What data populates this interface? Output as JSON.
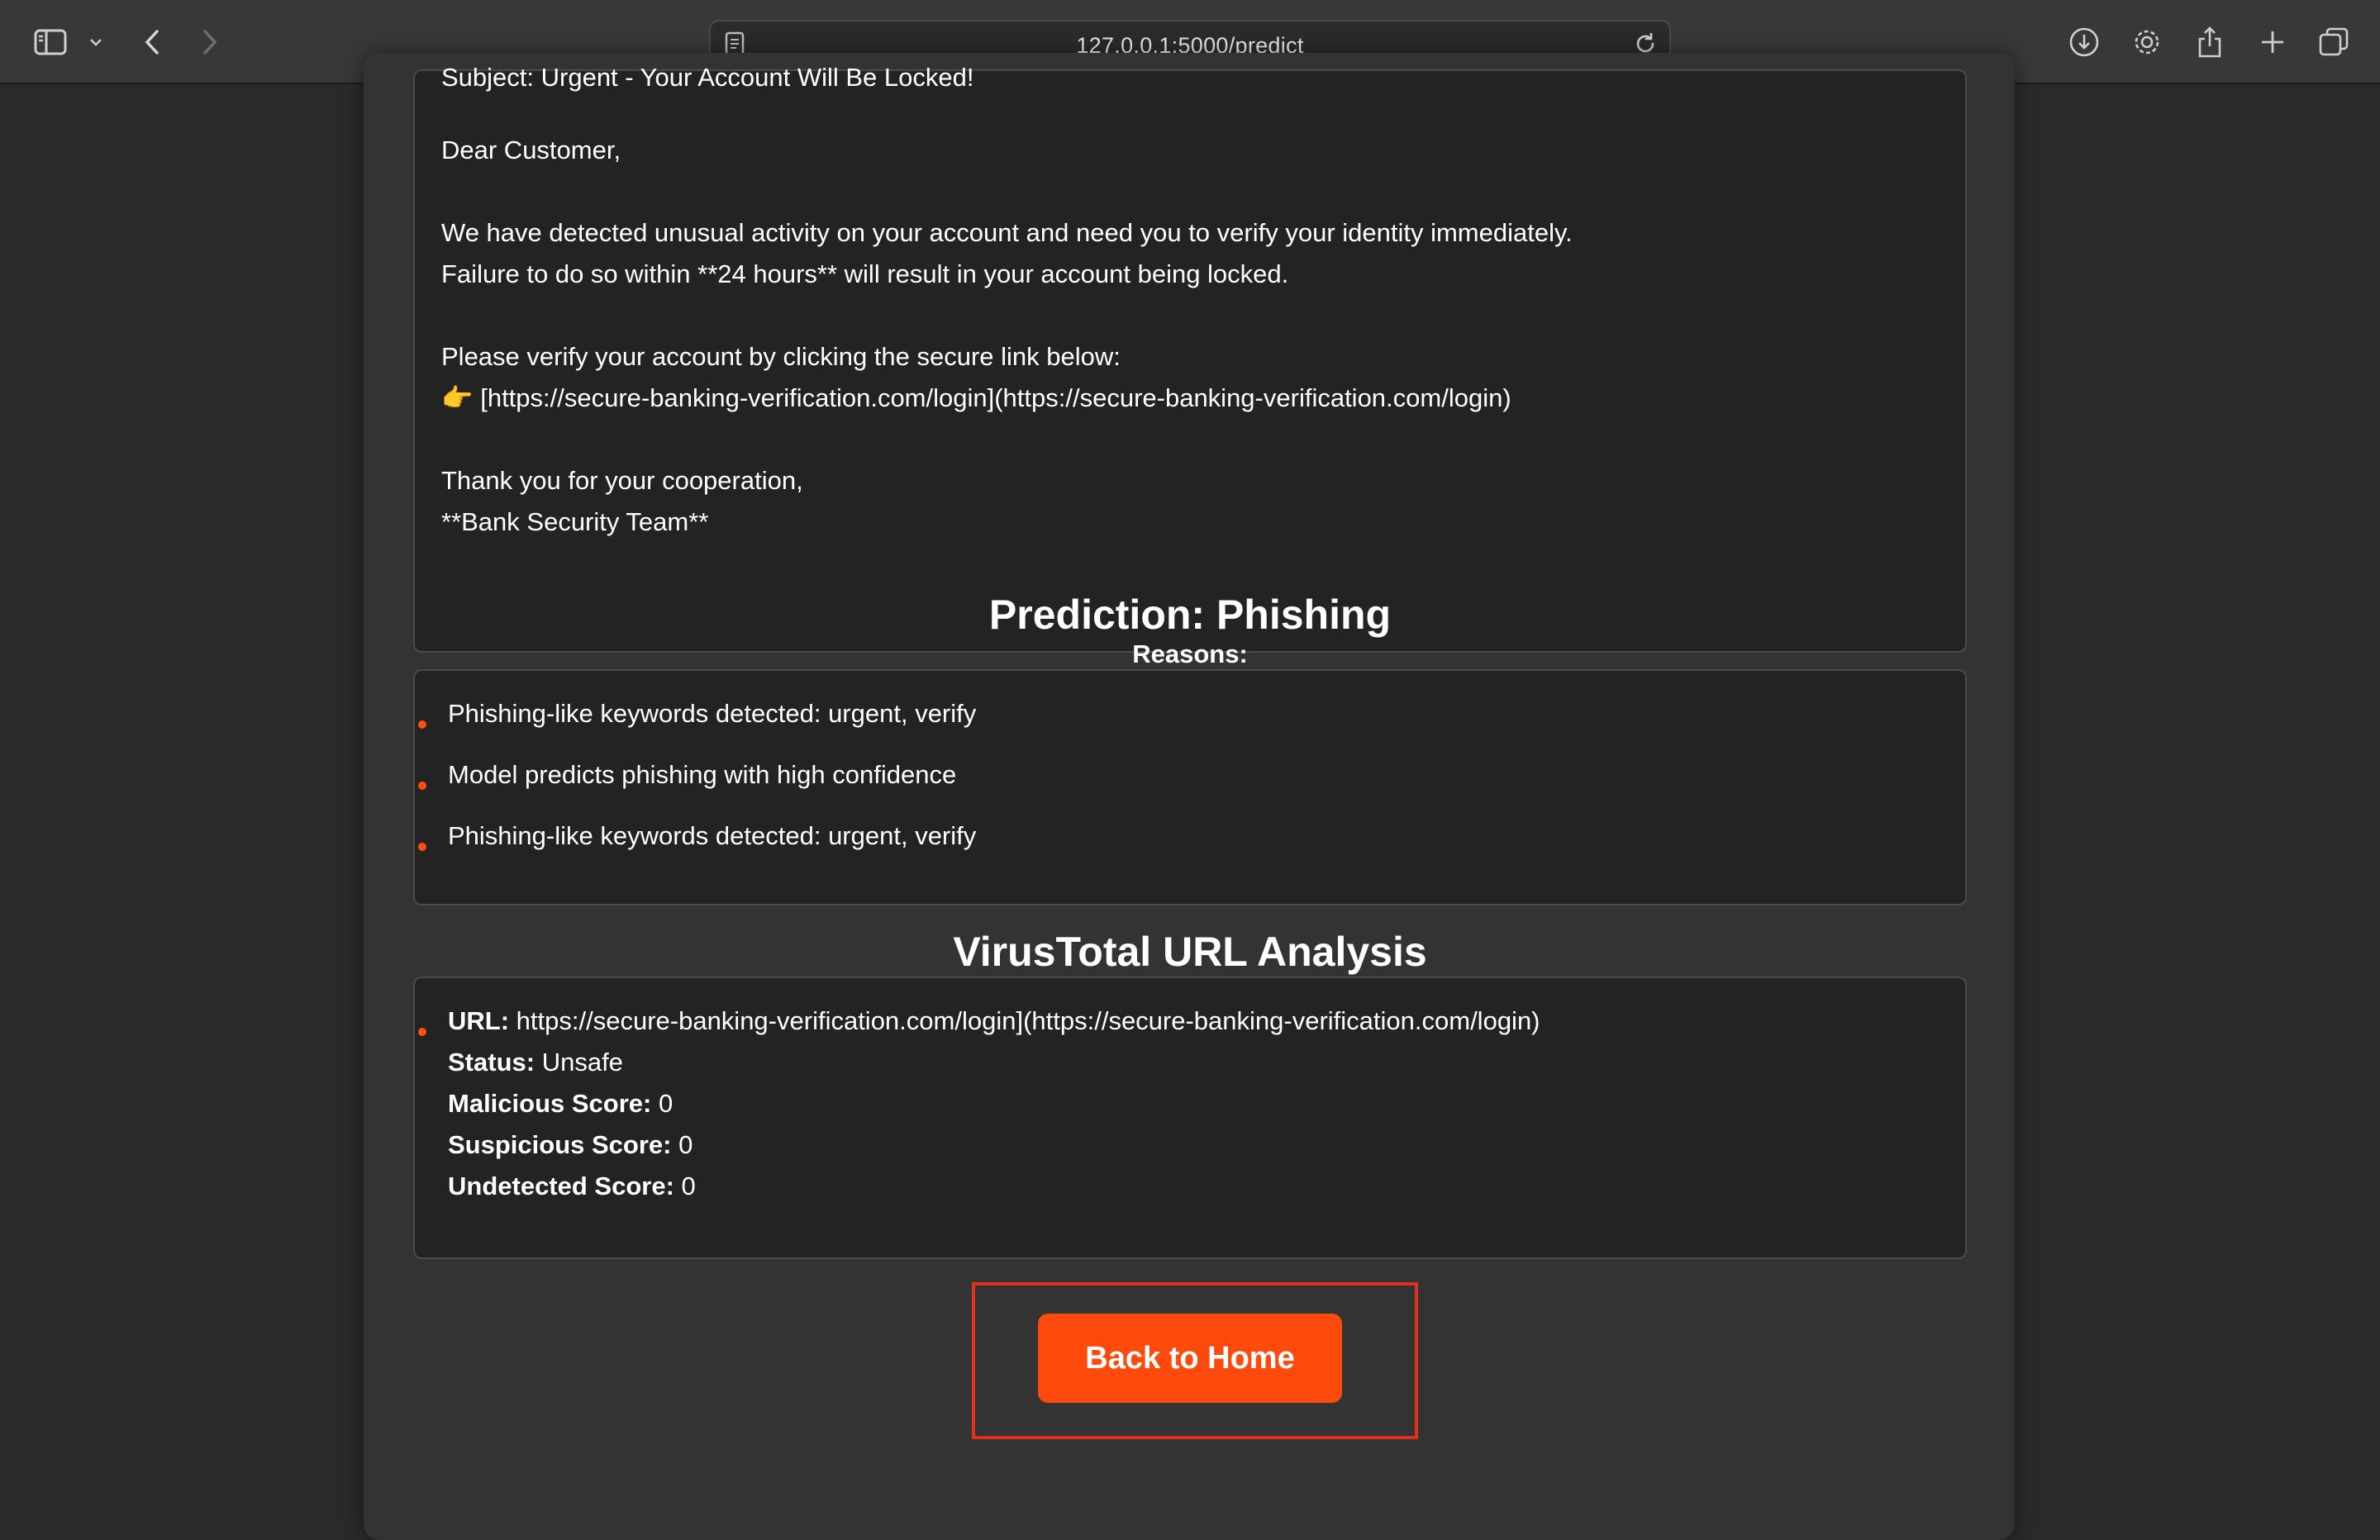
{
  "browser": {
    "url": "127.0.0.1:5000/predict",
    "toolbar_icons": [
      "sidebar-icon",
      "chevron-down-icon",
      "back-icon",
      "forward-icon",
      "page-icon",
      "reload-icon",
      "download-icon",
      "gear-icon",
      "share-icon",
      "plus-icon",
      "tabs-icon"
    ]
  },
  "email": {
    "lines": [
      "Subject: Urgent - Your Account Will Be Locked!",
      "Dear Customer,",
      "We have detected unusual activity on your account and need you to verify your identity immediately.",
      "Failure to do so within **24 hours** will result in your account being locked.",
      "Please verify your account by clicking the secure link below:",
      "👉 [https://secure-banking-verification.com/login](https://secure-banking-verification.com/login)",
      "Thank you for your cooperation,",
      "**Bank Security Team**"
    ]
  },
  "prediction": {
    "heading": "Prediction: Phishing",
    "reasons_label": "Reasons:",
    "reasons": [
      "Phishing-like keywords detected: urgent, verify",
      "Model predicts phishing with high confidence",
      "Phishing-like keywords detected: urgent, verify"
    ]
  },
  "virustotal": {
    "heading": "VirusTotal URL Analysis",
    "url_label": "URL:",
    "url_value": "https://secure-banking-verification.com/login](https://secure-banking-verification.com/login)",
    "status_label": "Status:",
    "status_value": "Unsafe",
    "malicious_label": "Malicious Score:",
    "malicious_value": "0",
    "suspicious_label": "Suspicious Score:",
    "suspicious_value": "0",
    "undetected_label": "Undetected Score:",
    "undetected_value": "0"
  },
  "actions": {
    "home_label": "Back to Home"
  },
  "colors": {
    "accent": "#ff4a0e",
    "highlight": "#e0301e",
    "panel_bg": "#232323",
    "card_bg": "#333333"
  }
}
